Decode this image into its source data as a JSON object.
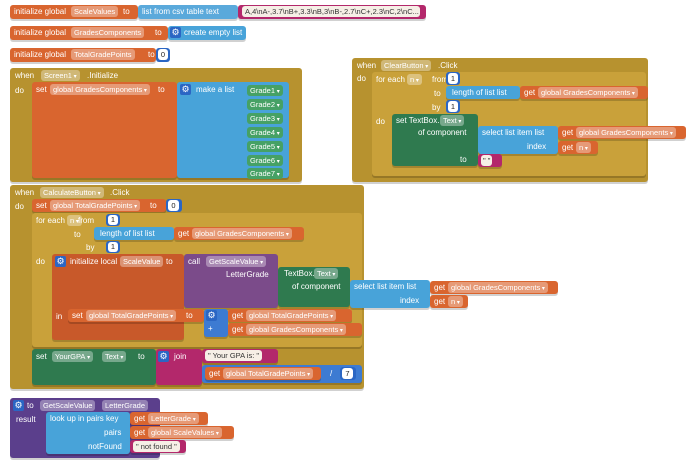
{
  "colors": {
    "variable": "#d9652f",
    "list": "#48a3d9",
    "control": "#b7922f",
    "component": "#2f7a4f",
    "procedure": "#7b4b8a",
    "text": "#b3286b",
    "math": "#2b66c4"
  },
  "globals": {
    "initialize_global": "initialize global",
    "to": "to",
    "scale_values_name": "ScaleValues",
    "list_from_csv": "list from csv table  text",
    "csv_text": "A,4\\nA-,3.7\\nB+,3.3\\nB,3\\nB-,2.7\\nC+,2.3\\nC,2\\nC...",
    "grades_components_name": "GradesComponents",
    "create_empty_list": "create empty list",
    "total_grade_points_name": "TotalGradePoints",
    "zero": "0"
  },
  "screen_init": {
    "when": "when",
    "component": "Screen1",
    "event": ".Initialize",
    "do": "do",
    "set": "set",
    "var": "global GradesComponents",
    "to": "to",
    "make_a_list": "make a list",
    "grades": [
      "Grade1",
      "Grade2",
      "Grade3",
      "Grade4",
      "Grade5",
      "Grade6",
      "Grade7"
    ]
  },
  "clear_button": {
    "when": "when",
    "component": "ClearButton",
    "event": ".Click",
    "do": "do",
    "for_each": "for each",
    "var_n": "n",
    "from": "from",
    "to": "to",
    "by": "by",
    "one": "1",
    "length_of_list": "length of list  list",
    "get": "get",
    "global_grades_components": "global GradesComponents",
    "set_textbox": "set TextBox.",
    "text_prop": "Text",
    "of_component": "of component",
    "select_list_item": "select list item  list",
    "index": "index",
    "get_n": "n",
    "to_label": "to",
    "empty_string": "\" \""
  },
  "calculate_button": {
    "when": "when",
    "component": "CalculateButton",
    "event": ".Click",
    "do": "do",
    "set": "set",
    "total_var": "global TotalGradePoints",
    "to": "to",
    "zero": "0",
    "for_each": "for each",
    "var_n": "n",
    "from": "from",
    "by": "by",
    "one": "1",
    "length_of_list": "length of list  list",
    "get": "get",
    "global_grades_components": "global GradesComponents",
    "initialize_local": "initialize local",
    "scale_value": "ScaleValue",
    "call": "call",
    "get_scale_value": "GetScaleValue",
    "letter_grade": "LetterGrade",
    "textbox": "TextBox.",
    "text_prop": "Text",
    "of_component": "of component",
    "select_list_item": "select list item  list",
    "index": "index",
    "get_n": "n",
    "in": "in",
    "global_total": "global TotalGradePoints",
    "plus": "+",
    "set_gpa": "set",
    "your_gpa": "YourGPA",
    "join": "join",
    "your_gpa_is": "\" Your GPA is: \"",
    "divide": "/",
    "seven": "7"
  },
  "procedure": {
    "to": "to",
    "name": "GetScaleValue",
    "param": "LetterGrade",
    "result": "result",
    "look_up_in_pairs": "look up in pairs  key",
    "get": "get",
    "letter_grade": "LetterGrade",
    "pairs": "pairs",
    "global_scale_values": "global ScaleValues",
    "not_found_label": "notFound",
    "not_found_value": "\" not found \""
  }
}
